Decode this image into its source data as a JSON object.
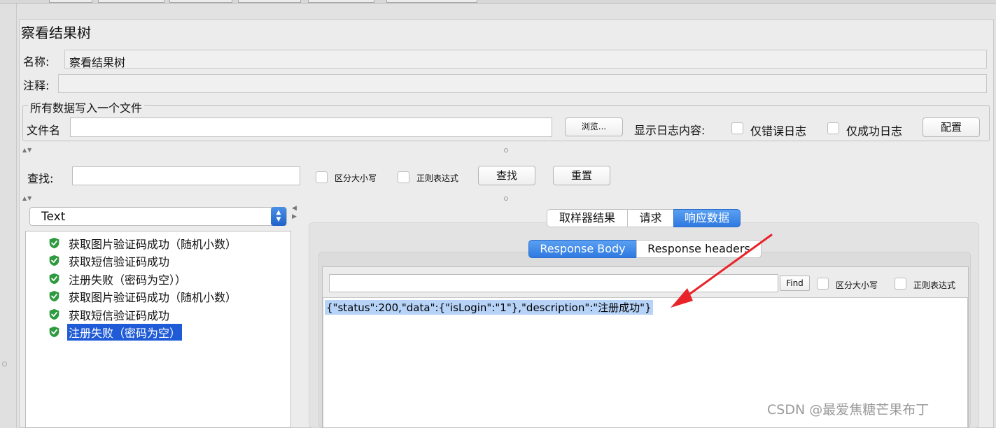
{
  "panel": {
    "title": "察看结果树"
  },
  "name_field": {
    "label": "名称:",
    "value": "察看结果树"
  },
  "comment_field": {
    "label": "注释:",
    "value": ""
  },
  "file_group": {
    "legend": "所有数据写入一个文件",
    "filename_label": "文件名",
    "filename_value": "",
    "browse_button": "浏览...",
    "log_label": "显示日志内容:",
    "errors_only": "仅错误日志",
    "success_only": "仅成功日志",
    "config_button": "配置"
  },
  "search_bar": {
    "label": "查找:",
    "value": "",
    "case_sensitive": "区分大小写",
    "regex": "正则表达式",
    "find_button": "查找",
    "reset_button": "重置"
  },
  "renderer_select": {
    "value": "Text"
  },
  "results_tree": {
    "items": [
      {
        "label": "获取图片验证码成功（随机小数）",
        "status": "success"
      },
      {
        "label": "获取短信验证码成功",
        "status": "success"
      },
      {
        "label": "注册失败（密码为空））",
        "status": "success"
      },
      {
        "label": "获取图片验证码成功（随机小数）",
        "status": "success"
      },
      {
        "label": "获取短信验证码成功",
        "status": "success"
      },
      {
        "label": "注册失败（密码为空）",
        "status": "success",
        "selected": true
      }
    ]
  },
  "result_tabs": {
    "tabs": [
      "取样器结果",
      "请求",
      "响应数据"
    ],
    "active": "响应数据"
  },
  "response_tabs": {
    "tabs": [
      "Response Body",
      "Response headers"
    ],
    "active": "Response Body"
  },
  "response_find": {
    "value": "",
    "find_button": "Find",
    "case_sensitive": "区分大小写",
    "regex": "正则表达式"
  },
  "response_body": {
    "text": "{\"status\":200,\"data\":{\"isLogin\":\"1\"},\"description\":\"注册成功\"}"
  },
  "colors": {
    "accent": "#2f79e0",
    "selection": "#1f5bd6",
    "annotation_arrow": "#e8242a",
    "success_icon": "#2e9a3f"
  },
  "watermark": "CSDN @最爱焦糖芒果布丁"
}
